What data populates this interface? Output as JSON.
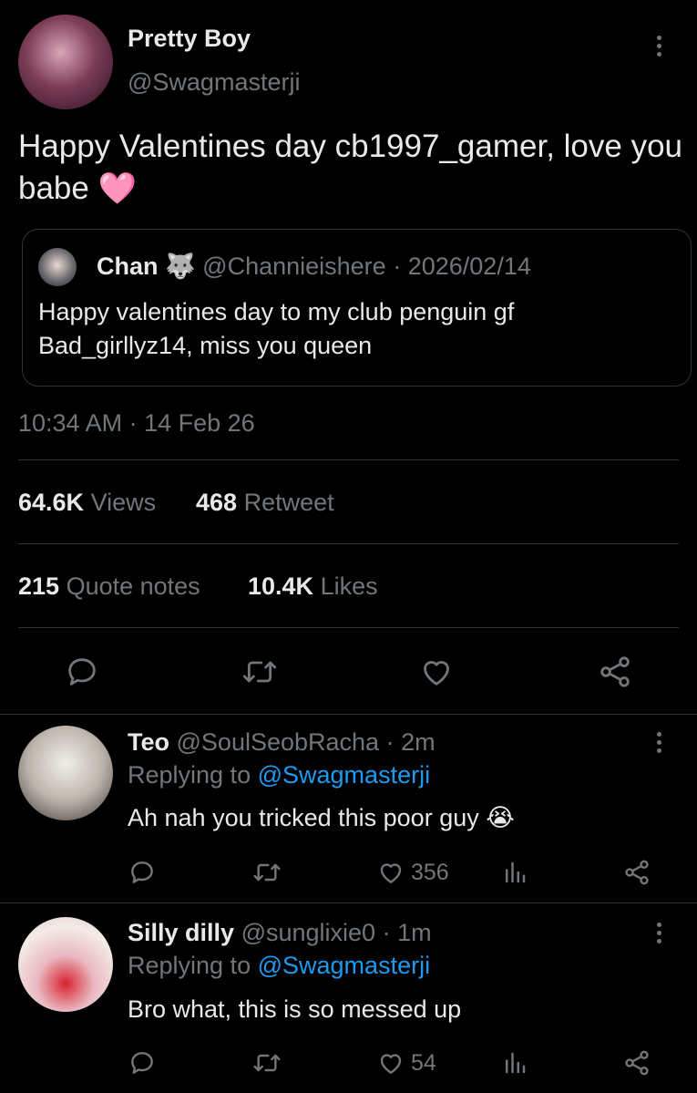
{
  "tweet": {
    "display_name": "Pretty Boy",
    "handle": "@Swagmasterji",
    "text": "Happy Valentines day cb1997_gamer, love you babe",
    "emoji": "🩷",
    "quote": {
      "display_name": "Chan",
      "name_emoji": "🐺",
      "handle": "@Channieishere",
      "sep": "·",
      "date": "2026/02/14",
      "text": "Happy valentines day to my club penguin gf Bad_girllyz14, miss you queen"
    },
    "timestamp": "10:34 AM · 14 Feb 26",
    "stats": {
      "views_count": "64.6K",
      "views_label": "Views",
      "retweet_count": "468",
      "retweet_label": "Retweet",
      "quote_count": "215",
      "quote_label": "Quote notes",
      "likes_count": "10.4K",
      "likes_label": "Likes"
    }
  },
  "replies": [
    {
      "display_name": "Teo",
      "handle": "@SoulSeobRacha",
      "sep": "·",
      "time": "2m",
      "replying_prefix": "Replying to",
      "replying_handle": "@Swagmasterji",
      "text": "Ah nah you tricked this poor guy",
      "emoji": "😭",
      "likes": "356"
    },
    {
      "display_name": "Silly dilly",
      "handle": "@sunglixie0",
      "sep": "·",
      "time": "1m",
      "replying_prefix": "Replying to",
      "replying_handle": "@Swagmasterji",
      "text": "Bro what, this is so messed up",
      "emoji": "",
      "likes": "54"
    }
  ],
  "colors": {
    "background": "#000000",
    "text": "#e7e9ea",
    "muted": "#71767b",
    "link": "#1d9bf0",
    "divider": "#2f3336"
  }
}
